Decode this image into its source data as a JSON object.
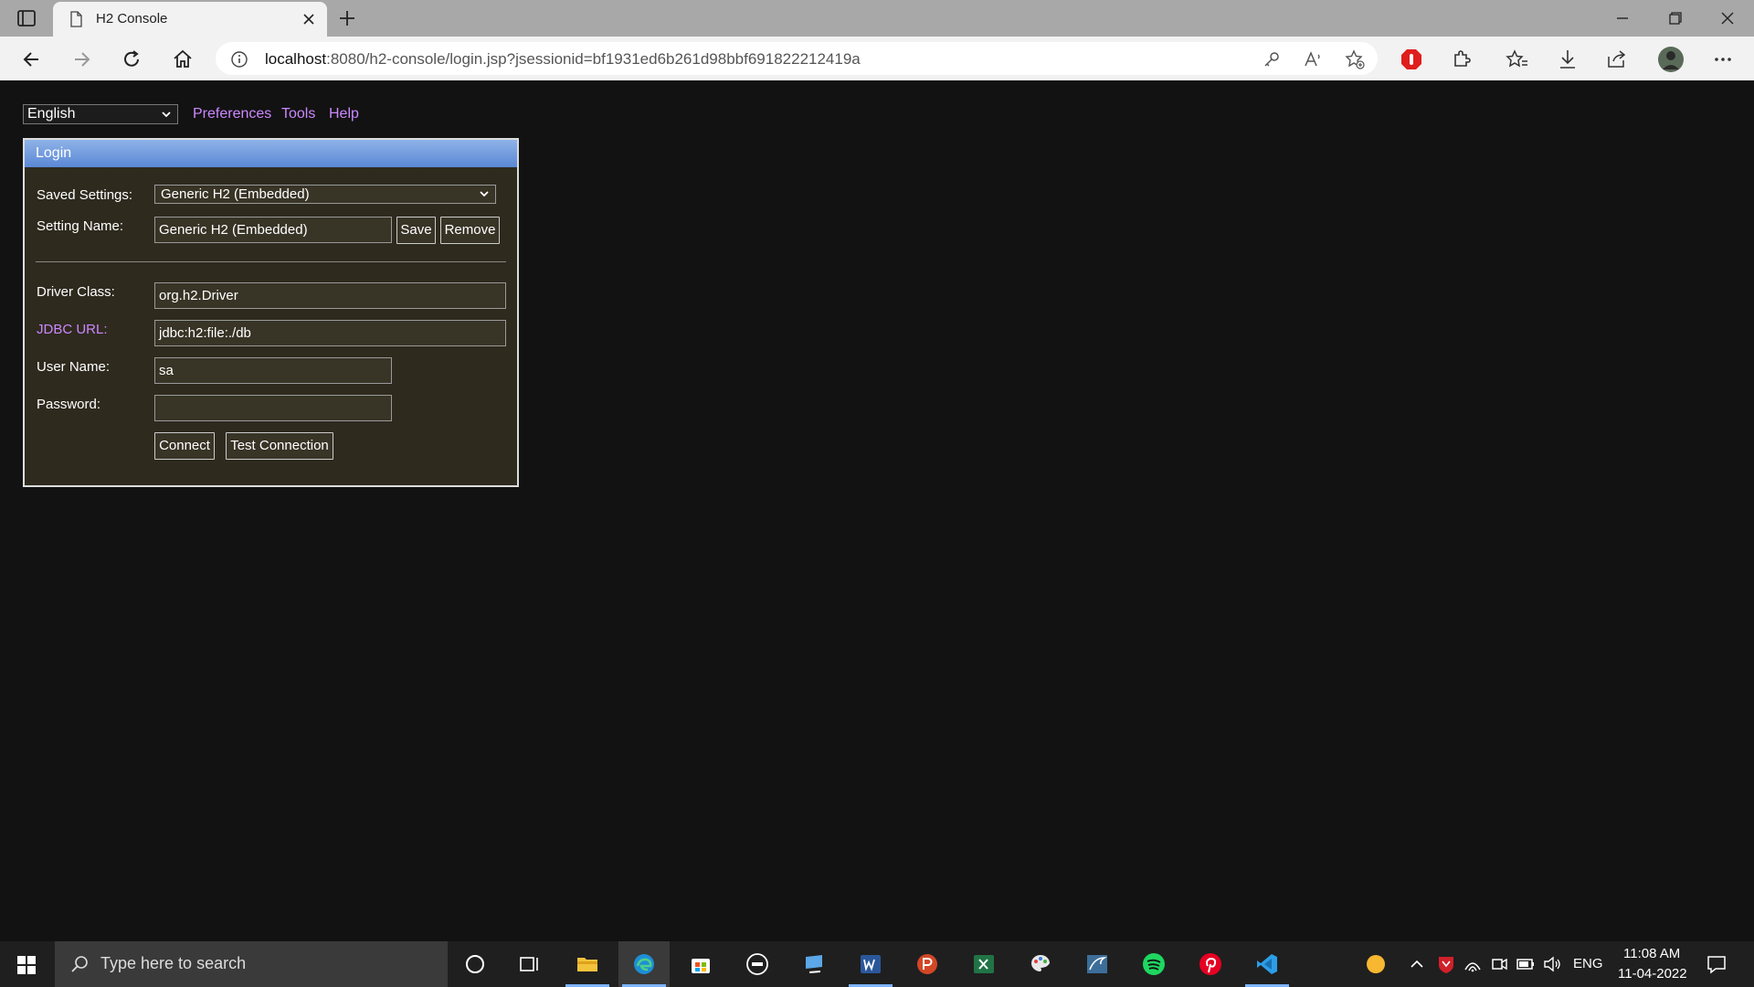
{
  "browser": {
    "tab_title": "H2 Console",
    "url_host": "localhost",
    "url_rest": ":8080/h2-console/login.jsp?jsessionid=bf1931ed6b261d98bbf691822212419a"
  },
  "topbar": {
    "language": "English",
    "links": [
      "Preferences",
      "Tools",
      "Help"
    ]
  },
  "login": {
    "header": "Login",
    "saved_settings_label": "Saved Settings:",
    "saved_settings_value": "Generic H2 (Embedded)",
    "setting_name_label": "Setting Name:",
    "setting_name_value": "Generic H2 (Embedded)",
    "save_label": "Save",
    "remove_label": "Remove",
    "driver_class_label": "Driver Class:",
    "driver_class_value": "org.h2.Driver",
    "jdbc_url_label": "JDBC URL:",
    "jdbc_url_value": "jdbc:h2:file:./db",
    "user_name_label": "User Name:",
    "user_name_value": "sa",
    "password_label": "Password:",
    "password_value": "",
    "connect_label": "Connect",
    "test_connection_label": "Test Connection"
  },
  "taskbar": {
    "search_placeholder": "Type here to search",
    "lang": "ENG",
    "time": "11:08 AM",
    "date": "11-04-2022"
  },
  "colors": {
    "accent_link": "#cc88ff",
    "panel_bg": "#2e2a1e",
    "header_blue": "#5a88d6"
  }
}
